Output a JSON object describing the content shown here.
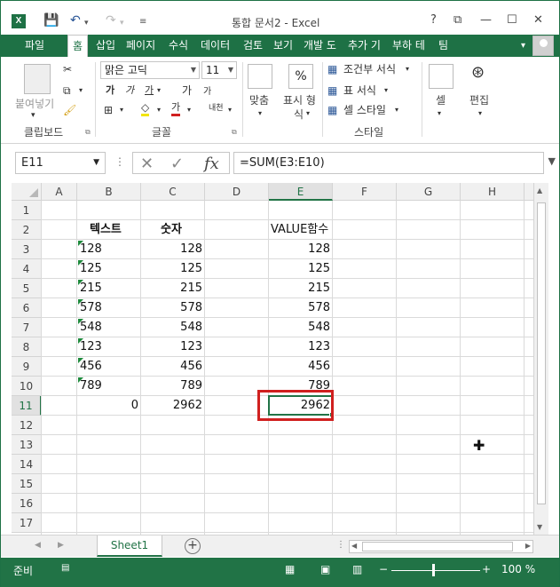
{
  "title": "통합 문서2 - Excel",
  "window_buttons": [
    "?",
    "⧉",
    "—",
    "☐",
    "✕"
  ],
  "tabs": [
    {
      "label": "파일",
      "active": false
    },
    {
      "label": "홈",
      "active": true
    },
    {
      "label": "삽입",
      "active": false
    },
    {
      "label": "페이지",
      "active": false
    },
    {
      "label": "수식",
      "active": false
    },
    {
      "label": "데이터",
      "active": false
    },
    {
      "label": "검토",
      "active": false
    },
    {
      "label": "보기",
      "active": false
    },
    {
      "label": "개발 도",
      "active": false
    },
    {
      "label": "추가 기",
      "active": false
    },
    {
      "label": "부하 테",
      "active": false
    },
    {
      "label": "팀",
      "active": false
    }
  ],
  "ribbon": {
    "clipboard": {
      "paste_label": "붙여넣기",
      "group_label": "클립보드"
    },
    "font": {
      "font_name": "맑은 고딕",
      "font_size": "11",
      "group_label": "글꼴",
      "bold": "가",
      "italic": "가",
      "underline": "가",
      "grow": "가",
      "shrink": "가",
      "phonetic": "내천"
    },
    "alignment": {
      "label": "맞춤"
    },
    "number": {
      "label_top": "표시 형",
      "label_bottom": "식",
      "symbol": "%"
    },
    "styles": {
      "conditional": "조건부 서식",
      "table": "표 서식",
      "cell_styles": "셀 스타일",
      "group_label": "스타일"
    },
    "cells": {
      "label": "셀"
    },
    "editing": {
      "label": "편집"
    }
  },
  "formula_bar": {
    "name_box": "E11",
    "formula": "=SUM(E3:E10)",
    "fx": "fx"
  },
  "columns": [
    "A",
    "B",
    "C",
    "D",
    "E",
    "F",
    "G",
    "H"
  ],
  "selected_column": "E",
  "rows": [
    "1",
    "2",
    "3",
    "4",
    "5",
    "6",
    "7",
    "8",
    "9",
    "10",
    "11",
    "12",
    "13",
    "14",
    "15",
    "16",
    "17"
  ],
  "selected_row": "11",
  "headers": {
    "b": "텍스트",
    "c": "숫자",
    "e": "VALUE함수"
  },
  "data_rows": [
    {
      "b": "128",
      "c": "128",
      "e": "128"
    },
    {
      "b": "125",
      "c": "125",
      "e": "125"
    },
    {
      "b": "215",
      "c": "215",
      "e": "215"
    },
    {
      "b": "578",
      "c": "578",
      "e": "578"
    },
    {
      "b": "548",
      "c": "548",
      "e": "548"
    },
    {
      "b": "123",
      "c": "123",
      "e": "123"
    },
    {
      "b": "456",
      "c": "456",
      "e": "456"
    },
    {
      "b": "789",
      "c": "789",
      "e": "789"
    }
  ],
  "totals": {
    "b": "0",
    "c": "2962",
    "e": "2962"
  },
  "sheet_tab": "Sheet1",
  "status": {
    "ready": "준비",
    "zoom": "100 %"
  },
  "colors": {
    "accent": "#217346",
    "highlight_box": "#d0201f"
  }
}
